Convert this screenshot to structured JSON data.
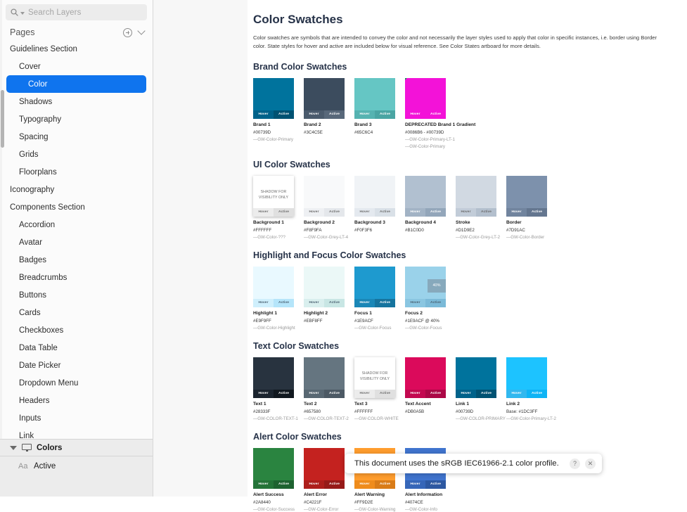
{
  "sidebar": {
    "search": {
      "placeholder": "Search Layers",
      "icon": "search-icon"
    },
    "pages_label": "Pages",
    "add_icon": "plus-circle-icon",
    "collapse_icon": "chevron-down-icon",
    "tree": [
      {
        "label": "Guidelines Section",
        "level": 0,
        "selected": false
      },
      {
        "label": "Cover",
        "level": 1,
        "selected": false
      },
      {
        "label": "Color",
        "level": 1,
        "selected": true
      },
      {
        "label": "Shadows",
        "level": 1,
        "selected": false
      },
      {
        "label": "Typography",
        "level": 1,
        "selected": false
      },
      {
        "label": "Spacing",
        "level": 1,
        "selected": false
      },
      {
        "label": "Grids",
        "level": 1,
        "selected": false
      },
      {
        "label": "Floorplans",
        "level": 1,
        "selected": false
      },
      {
        "label": "Iconography",
        "level": 0,
        "selected": false
      },
      {
        "label": "Components Section",
        "level": 0,
        "selected": false
      },
      {
        "label": "Accordion",
        "level": 1,
        "selected": false
      },
      {
        "label": "Avatar",
        "level": 1,
        "selected": false
      },
      {
        "label": "Badges",
        "level": 1,
        "selected": false
      },
      {
        "label": "Breadcrumbs",
        "level": 1,
        "selected": false
      },
      {
        "label": "Buttons",
        "level": 1,
        "selected": false
      },
      {
        "label": "Cards",
        "level": 1,
        "selected": false
      },
      {
        "label": "Checkboxes",
        "level": 1,
        "selected": false
      },
      {
        "label": "Data Table",
        "level": 1,
        "selected": false
      },
      {
        "label": "Date Picker",
        "level": 1,
        "selected": false
      },
      {
        "label": "Dropdown Menu",
        "level": 1,
        "selected": false
      },
      {
        "label": "Headers",
        "level": 1,
        "selected": false
      },
      {
        "label": "Inputs",
        "level": 1,
        "selected": false
      },
      {
        "label": "Link",
        "level": 1,
        "selected": false
      }
    ],
    "layer_header": {
      "label": "Colors",
      "icon": "artboard-icon",
      "disclosure": "triangle-down-icon"
    },
    "layers": [
      {
        "type": "Aa",
        "name": "Active"
      }
    ],
    "selection_color": "#0f74ee"
  },
  "document": {
    "title": "Color Swatches",
    "intro": "Color swatches are symbols that are intended to convey the color and not necessarily the layer styles used to apply that color in specific instances, i.e. border using Border color. State styles for hover and active are included below for visual reference. See Color States artboard for more details.",
    "state_labels": {
      "hover": "Hover",
      "active": "Active"
    },
    "shadow_note": "SHADOW FOR\nVISIBILITY ONLY",
    "sections": [
      {
        "title": "Brand Color Swatches",
        "swatches": [
          {
            "name": "Brand 1",
            "hex": "#00739D",
            "token": "—GW-Color-Primary",
            "fill": "#00739D",
            "hover": "#00628a",
            "active": "#005272",
            "state_text": "#ffffff",
            "wide": false
          },
          {
            "name": "Brand 2",
            "hex": "#3C4C5E",
            "token": "",
            "fill": "#3C4C5E",
            "hover": "#4b5b6d",
            "active": "#58687a",
            "state_text": "#ffffff",
            "wide": false
          },
          {
            "name": "Brand 3",
            "hex": "#65C6C4",
            "token": "",
            "fill": "#65C6C4",
            "hover": "#56b3b1",
            "active": "#4aa5a3",
            "state_text": "#ffffff",
            "wide": false
          },
          {
            "name": "DEPRECATED Brand 1 Gradient",
            "hex": "#0086B6 - #00739D",
            "token": "—GW-Color-Primary-LT-1\n—GW-Color-Primary",
            "fill": "#F312D8",
            "hover": "#f312d8",
            "active": "#f312d8",
            "state_text": "#ffffff",
            "wide": true,
            "gradient": true
          }
        ]
      },
      {
        "title": "UI Color Swatches",
        "swatches": [
          {
            "name": "Background 1",
            "hex": "#FFFFFF",
            "token": "—GW-Color-???",
            "fill": "#FFFFFF",
            "hover": "#ececec",
            "active": "#e0e0e0",
            "state_text": "#6b6b6b",
            "shadow": true,
            "shadow_label": true
          },
          {
            "name": "Background 2",
            "hex": "#F8F9FA",
            "token": "—GW-Color-Grey-LT-4",
            "fill": "#F8F9FA",
            "hover": "#eef0f3",
            "active": "#e4e7eb",
            "state_text": "#6b6b6b"
          },
          {
            "name": "Background 3",
            "hex": "#F0F3F6",
            "token": "",
            "fill": "#F0F3F6",
            "hover": "#e4e9ef",
            "active": "#d9e0e7",
            "state_text": "#6b6b6b"
          },
          {
            "name": "Background 4",
            "hex": "#B1C0D0",
            "token": "",
            "fill": "#B1C0D0",
            "hover": "#a2b3c5",
            "active": "#93a6ba",
            "state_text": "#ffffff"
          },
          {
            "name": "Stroke",
            "hex": "#D1D9E2",
            "token": "—GW-Color-Grey-LT-2",
            "fill": "#D1D9E2",
            "hover": "#c2ccd8",
            "active": "#b3bfcd",
            "state_text": "#6b6b6b"
          },
          {
            "name": "Border",
            "hex": "#7D91AC",
            "token": "—GW-Color-Border",
            "fill": "#7D91AC",
            "hover": "#71849e",
            "active": "#64768f",
            "state_text": "#ffffff"
          }
        ]
      },
      {
        "title": "Highlight and Focus Color Swatches",
        "swatches": [
          {
            "name": "Highlight 1",
            "hex": "#E9F9FF",
            "token": "—GW-Color-Highlight",
            "fill": "#E9F9FF",
            "hover": "#cfeffc",
            "active": "#b5e5fa",
            "state_text": "#4a6070"
          },
          {
            "name": "Highlight 2",
            "hex": "#EBF8FF",
            "token": "",
            "fill": "#EBF8F7",
            "hover": "#d9efee",
            "active": "#c8e6e4",
            "state_text": "#4a6070"
          },
          {
            "name": "Focus 1",
            "hex": "#1E9ACF",
            "token": "—GW-Color-Focus",
            "fill": "#1E9ACF",
            "hover": "#1a87b7",
            "active": "#16749e",
            "state_text": "#ffffff"
          },
          {
            "name": "Focus 2",
            "hex": "#1E9ACF @ 40%",
            "token": "—GW-Color-Focus",
            "fill": "#9ad2ea",
            "hover": "#8ac6e1",
            "active": "#7bbad8",
            "state_text": "#4a6070",
            "badge": "40%"
          }
        ]
      },
      {
        "title": "Text Color Swatches",
        "swatches": [
          {
            "name": "Text 1",
            "hex": "#28333F",
            "token": "—GW-COLOR-TEXT-1",
            "fill": "#28333F",
            "hover": "#1b242e",
            "active": "#11181f",
            "state_text": "#ffffff"
          },
          {
            "name": "Text 2",
            "hex": "#657580",
            "token": "—GW-COLOR-TEXT-2",
            "fill": "#657580",
            "hover": "#586772",
            "active": "#4c5964",
            "state_text": "#ffffff"
          },
          {
            "name": "Text 3",
            "hex": "#FFFFFF",
            "token": "—GW-COLOR-WHITE",
            "fill": "#FFFFFF",
            "hover": "#ececec",
            "active": "#e0e0e0",
            "state_text": "#6b6b6b",
            "shadow": true,
            "shadow_label": true
          },
          {
            "name": "Text Accent",
            "hex": "#DB0A5B",
            "token": "",
            "fill": "#DB0A5B",
            "hover": "#c30950",
            "active": "#ab0846",
            "state_text": "#ffffff"
          },
          {
            "name": "Link 1",
            "hex": "#00739D",
            "token": "—GW-COLOR-PRIMARY",
            "fill": "#00739D",
            "hover": "#00628a",
            "active": "#005272",
            "state_text": "#ffffff"
          },
          {
            "name": "Link 2",
            "hex": "Base: #1DC3FF",
            "token": "—GW-Color-Primary-LT-2",
            "fill": "#1DC3FF",
            "hover": "#31b8ef",
            "active": "#0fb4f5",
            "state_text": "#ffffff"
          }
        ]
      },
      {
        "title": "Alert Color Swatches",
        "swatches": [
          {
            "name": "Alert Success",
            "hex": "#2A8440",
            "token": "—GW-Color-Success",
            "fill": "#2A8440",
            "hover": "#247338",
            "active": "#1e6230",
            "state_text": "#ffffff"
          },
          {
            "name": "Alert Error",
            "hex": "#C4221F",
            "token": "—GW-Color-Error",
            "fill": "#C4221F",
            "hover": "#ad1e1b",
            "active": "#961a18",
            "state_text": "#ffffff"
          },
          {
            "name": "Alert Warning",
            "hex": "#FF9D2E",
            "token": "—GW-Color-Warning",
            "fill": "#FF9D2E",
            "hover": "#ef8c1c",
            "active": "#d97c18",
            "state_text": "#ffffff"
          },
          {
            "name": "Alert Information",
            "hex": "#4074CE",
            "token": "—GW-Color-Info",
            "fill": "#4074CE",
            "hover": "#3666b8",
            "active": "#2d58a1",
            "state_text": "#ffffff"
          }
        ]
      }
    ]
  },
  "toast": {
    "message": "This document uses the sRGB IEC61966-2.1 color profile.",
    "help_label": "?",
    "close_label": "✕"
  }
}
